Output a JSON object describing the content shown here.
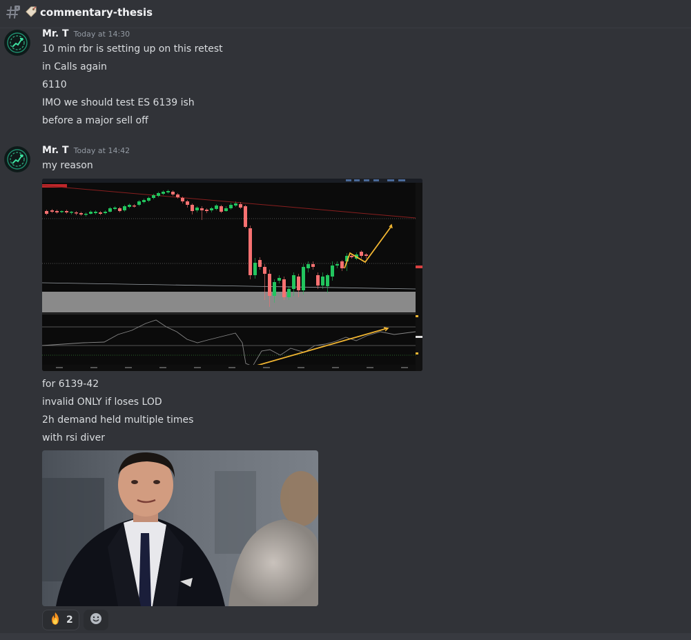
{
  "channel": {
    "name": "commentary-thesis",
    "hash_icon": "hash-lock-icon",
    "tag_emoji": "label-tag-icon"
  },
  "messages": [
    {
      "author": "Mr. T",
      "timestamp": "Today at 14:30",
      "lines": [
        "10 min rbr is setting up on this retest",
        "in Calls again",
        "6110",
        "IMO we should test ES 6139 ish",
        "before a major sell off"
      ]
    },
    {
      "author": "Mr. T",
      "timestamp": "Today at 14:42",
      "lines_before_image": [
        "my reason"
      ],
      "lines_after_image": [
        "for 6139-42",
        "invalid ONLY if loses LOD",
        "2h demand held multiple times",
        "with rsi diver"
      ],
      "attachments": [
        "chart-screenshot",
        "reaction-gif"
      ]
    }
  ],
  "reactions": [
    {
      "emoji": "fire-icon",
      "count": "2"
    }
  ],
  "add_reaction_icon": "smiley-add-reaction-icon",
  "colors": {
    "background": "#313338",
    "text": "#dbdee1",
    "author": "#f2f3f5",
    "timestamp": "#949ba4",
    "bull_candle": "#22c55e",
    "bear_candle": "#f87171",
    "annotation": "#f2b632"
  }
}
